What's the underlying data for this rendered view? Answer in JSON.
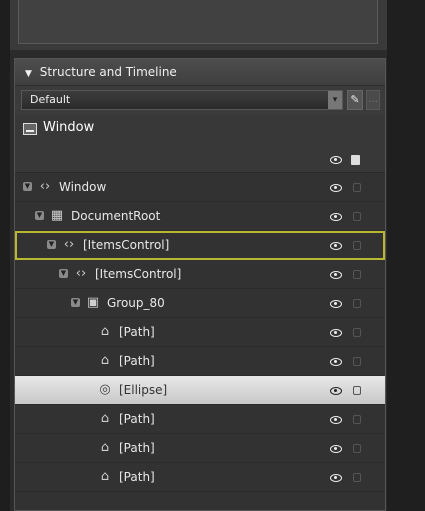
{
  "panel": {
    "title": "Structure and Timeline",
    "collapse_glyph": "▼",
    "storyboard": {
      "selected": "Default",
      "arrow": "▾"
    },
    "pin_glyph": "✎",
    "extra_glyph": "…"
  },
  "root": {
    "label": "Window",
    "icon": "window-icon"
  },
  "tree": [
    {
      "label": "Window",
      "icon": "element-icon",
      "glyph": "‹›",
      "indent": 0,
      "expanded": true
    },
    {
      "label": "DocumentRoot",
      "icon": "grid-icon",
      "glyph": "▦",
      "indent": 1,
      "expanded": true
    },
    {
      "label": "[ItemsControl]",
      "icon": "element-icon",
      "glyph": "‹›",
      "indent": 2,
      "expanded": true,
      "outlined": true
    },
    {
      "label": "[ItemsControl]",
      "icon": "element-icon",
      "glyph": "‹›",
      "indent": 3,
      "expanded": true
    },
    {
      "label": "Group_80",
      "icon": "canvas-icon",
      "glyph": "▣",
      "indent": 4,
      "expanded": true
    },
    {
      "label": "[Path]",
      "icon": "path-icon",
      "glyph": "⌂",
      "indent": 5
    },
    {
      "label": "[Path]",
      "icon": "path-icon",
      "glyph": "⌂",
      "indent": 5
    },
    {
      "label": "[Ellipse]",
      "icon": "ellipse-icon",
      "glyph": "◎",
      "indent": 5,
      "highlighted": true
    },
    {
      "label": "[Path]",
      "icon": "path-icon",
      "glyph": "⌂",
      "indent": 5
    },
    {
      "label": "[Path]",
      "icon": "path-icon",
      "glyph": "⌂",
      "indent": 5
    },
    {
      "label": "[Path]",
      "icon": "path-icon",
      "glyph": "⌂",
      "indent": 5
    }
  ],
  "colors": {
    "outline": "#b8b830",
    "highlight": "#e0e0e0"
  }
}
